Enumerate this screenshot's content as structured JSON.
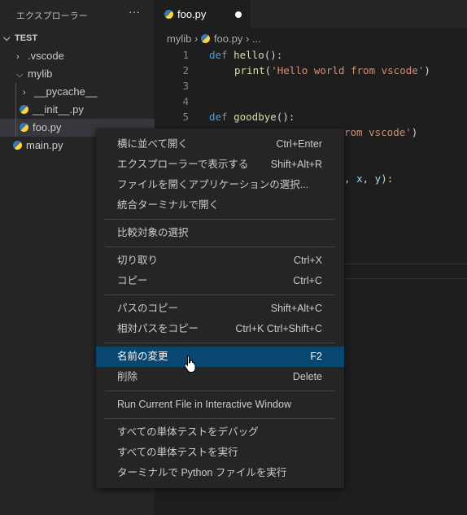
{
  "sidebar": {
    "title": "エクスプローラー",
    "more": "···",
    "root": "TEST",
    "items": [
      {
        "label": ".vscode",
        "type": "folder",
        "expanded": false
      },
      {
        "label": "mylib",
        "type": "folder",
        "expanded": true
      },
      {
        "label": "__pycache__",
        "type": "folder",
        "expanded": false
      },
      {
        "label": "__init__.py",
        "type": "python-file"
      },
      {
        "label": "foo.py",
        "type": "python-file",
        "selected": true
      },
      {
        "label": "main.py",
        "type": "python-file"
      }
    ]
  },
  "tab": {
    "label": "foo.py",
    "modified": true
  },
  "breadcrumb": {
    "folder": "mylib",
    "file": "foo.py",
    "more": "..."
  },
  "editor": {
    "line_numbers": [
      "1",
      "2",
      "3",
      "4",
      "5"
    ],
    "l1": {
      "kw": "def",
      "fn": "hello",
      "rest": "():"
    },
    "l2": {
      "fn": "print",
      "p1": "(",
      "str": "'Hello world from vscode'",
      "p2": ")"
    },
    "l5": {
      "kw": "def",
      "fn": "goodbye",
      "rest": "():"
    },
    "l6_visible": {
      "str": "rom vscode'",
      "p": ")"
    },
    "l8_visible": {
      "a": ", ",
      "x": "x",
      ",": ", ",
      "y": "y",
      "end": "):"
    }
  },
  "context_menu": {
    "groups": [
      [
        {
          "label": "横に並べて開く",
          "shortcut": "Ctrl+Enter"
        },
        {
          "label": "エクスプローラーで表示する",
          "shortcut": "Shift+Alt+R"
        },
        {
          "label": "ファイルを開くアプリケーションの選択...",
          "shortcut": ""
        },
        {
          "label": "統合ターミナルで開く",
          "shortcut": ""
        }
      ],
      [
        {
          "label": "比較対象の選択",
          "shortcut": ""
        }
      ],
      [
        {
          "label": "切り取り",
          "shortcut": "Ctrl+X"
        },
        {
          "label": "コピー",
          "shortcut": "Ctrl+C"
        }
      ],
      [
        {
          "label": "パスのコピー",
          "shortcut": "Shift+Alt+C"
        },
        {
          "label": "相対パスをコピー",
          "shortcut": "Ctrl+K Ctrl+Shift+C"
        }
      ],
      [
        {
          "label": "名前の変更",
          "shortcut": "F2",
          "highlighted": true
        },
        {
          "label": "削除",
          "shortcut": "Delete"
        }
      ],
      [
        {
          "label": "Run Current File in Interactive Window",
          "shortcut": ""
        }
      ],
      [
        {
          "label": "すべての単体テストをデバッグ",
          "shortcut": ""
        },
        {
          "label": "すべての単体テストを実行",
          "shortcut": ""
        },
        {
          "label": "ターミナルで Python ファイルを実行",
          "shortcut": ""
        }
      ]
    ]
  },
  "colors": {
    "accent": "#094771",
    "sidebar": "#252526",
    "editor": "#1e1e1e",
    "keyword": "#569cd6",
    "function": "#dcdcaa",
    "string": "#ce9178"
  }
}
